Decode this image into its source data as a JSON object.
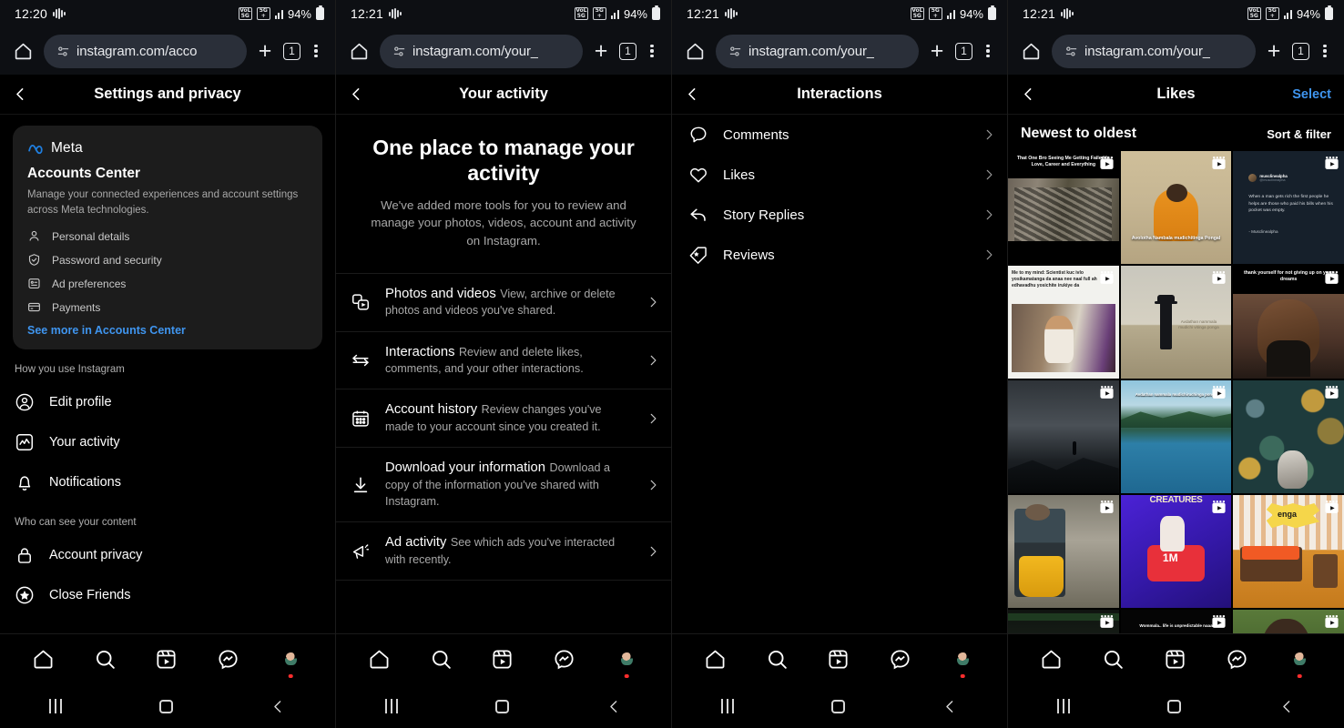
{
  "status": {
    "time_1": "12:20",
    "time_2": "12:21",
    "time_3": "12:21",
    "time_4": "12:21",
    "battery": "94%",
    "net_badge_1": "VoLTE 5G",
    "net_badge_2": "5G+",
    "icons": [
      "audio-wave-icon",
      "volte-icon",
      "fiveg-icon",
      "signal-bars-icon",
      "battery-icon"
    ]
  },
  "browser": {
    "url_1": "instagram.com/acco",
    "url_2": "instagram.com/your_",
    "url_3": "instagram.com/your_",
    "url_4": "instagram.com/your_",
    "tab_count": "1",
    "new_tab_label": "+",
    "icons": [
      "home-icon",
      "page-info-icon",
      "new-tab-icon",
      "tab-switcher-icon",
      "overflow-menu-icon"
    ]
  },
  "panel1": {
    "header": {
      "title": "Settings and privacy",
      "back": "back-icon"
    },
    "meta_card": {
      "brand": "Meta",
      "title": "Accounts Center",
      "description": "Manage your connected experiences and account settings across Meta technologies.",
      "items": [
        {
          "label": "Personal details",
          "icon": "person-icon"
        },
        {
          "label": "Password and security",
          "icon": "shield-check-icon"
        },
        {
          "label": "Ad preferences",
          "icon": "ad-preferences-icon"
        },
        {
          "label": "Payments",
          "icon": "credit-card-icon"
        }
      ],
      "link": "See more in Accounts Center",
      "link_color": "#3f95ef"
    },
    "sections": [
      {
        "label": "How you use Instagram",
        "items": [
          {
            "label": "Edit profile",
            "icon": "profile-circle-icon"
          },
          {
            "label": "Your activity",
            "icon": "activity-chart-icon"
          },
          {
            "label": "Notifications",
            "icon": "bell-icon"
          }
        ]
      },
      {
        "label": "Who can see your content",
        "items": [
          {
            "label": "Account privacy",
            "icon": "lock-icon"
          },
          {
            "label": "Close Friends",
            "icon": "star-circle-icon"
          }
        ]
      }
    ]
  },
  "panel2": {
    "header": {
      "title": "Your activity",
      "back": "back-icon"
    },
    "hero": {
      "title": "One place to manage your activity",
      "subtitle": "We've added more tools for you to review and manage your photos, videos, account and activity on Instagram."
    },
    "rows": [
      {
        "title": "Photos and videos",
        "subtitle": "View, archive or delete photos and videos you've shared.",
        "icon": "photos-videos-icon"
      },
      {
        "title": "Interactions",
        "subtitle": "Review and delete likes, comments, and your other interactions.",
        "icon": "interactions-arrows-icon"
      },
      {
        "title": "Account history",
        "subtitle": "Review changes you've made to your account since you created it.",
        "icon": "calendar-icon"
      },
      {
        "title": "Download your information",
        "subtitle": "Download a copy of the information you've shared with Instagram.",
        "icon": "download-icon"
      },
      {
        "title": "Ad activity",
        "subtitle": "See which ads you've interacted with recently.",
        "icon": "megaphone-icon"
      }
    ]
  },
  "panel3": {
    "header": {
      "title": "Interactions",
      "back": "back-icon"
    },
    "rows": [
      {
        "label": "Comments",
        "icon": "comment-bubble-icon"
      },
      {
        "label": "Likes",
        "icon": "heart-icon"
      },
      {
        "label": "Story Replies",
        "icon": "reply-arrow-icon"
      },
      {
        "label": "Reviews",
        "icon": "tag-star-icon"
      }
    ]
  },
  "panel4": {
    "header": {
      "title": "Likes",
      "back": "back-icon",
      "action": "Select",
      "action_color": "#3f95ef"
    },
    "sort": {
      "current": "Newest to oldest",
      "filter": "Sort & filter"
    },
    "grid": [
      {
        "id": "cell-1",
        "caption": "That One Bro Seeing Me Getting Failed In Love, Career and Everything",
        "caption_color": "#ffffff",
        "reel": true,
        "style": "aerial-ruins"
      },
      {
        "id": "cell-2",
        "caption": "Avolotha Nambala mudichitinga Pongal",
        "caption_color": "#ffffff",
        "reel": true,
        "style": "desert-man-orange"
      },
      {
        "id": "cell-3",
        "caption": "When a man gets rich the first people he helps are those who paid his bills when his pocket was empty.",
        "caption_color": "#d7dbe0",
        "reel": true,
        "style": "tweet-card",
        "handle": "musclinealpha",
        "handle_sub": "@musclinealpha",
        "signature": "- Musclinealpha"
      },
      {
        "id": "cell-4",
        "caption": "Me to my mind: Scientist kuc ivlo yosikamatanga da anaa nee naal full ah edhavadhu yosichite irukiye da",
        "caption_color": "#1c1c1c",
        "reel": true,
        "style": "meme-white-top"
      },
      {
        "id": "cell-5",
        "caption": "Avdathan nammala mudichi vitinga ponga",
        "caption_color": "#d8d2c4",
        "reel": true,
        "style": "field-hat-man"
      },
      {
        "id": "cell-6",
        "caption": "thank yourself for not giving up on your dreams",
        "caption_color": "#ffffff",
        "reel": true,
        "style": "portrait-man"
      },
      {
        "id": "cell-7",
        "caption": "",
        "caption_color": "#bdbdbd",
        "reel": true,
        "style": "cliff-silhouette"
      },
      {
        "id": "cell-8",
        "caption": "Avdathan nammala mudichiruchinga ponga",
        "caption_color": "#ffffff",
        "reel": true,
        "style": "lake-landscape"
      },
      {
        "id": "cell-9",
        "caption": "",
        "caption_color": "#ffffff",
        "reel": true,
        "style": "floral-wallpaper"
      },
      {
        "id": "cell-10",
        "caption": "",
        "caption_color": "#ffffff",
        "reel": true,
        "style": "boy-bucket"
      },
      {
        "id": "cell-11",
        "caption": "1M",
        "caption_color": "#ffffff",
        "reel": true,
        "style": "one-million-blue",
        "banner": "CREATURES"
      },
      {
        "id": "cell-12",
        "caption": "enga",
        "caption_color": "#1a1a1a",
        "reel": true,
        "style": "room-orange"
      },
      {
        "id": "cell-13",
        "caption": "",
        "caption_color": "#ffffff",
        "reel": true,
        "style": "dark-video"
      },
      {
        "id": "cell-14",
        "caption": "Wommala.. life is unpredictable naaa",
        "caption_color": "#ffffff",
        "reel": true,
        "style": "dark-caption"
      },
      {
        "id": "cell-15",
        "caption": "",
        "caption_color": "#ffffff",
        "reel": true,
        "style": "green-selfie"
      }
    ]
  },
  "tabbar": {
    "items": [
      {
        "name": "home",
        "icon": "home-icon"
      },
      {
        "name": "search",
        "icon": "search-icon"
      },
      {
        "name": "reels",
        "icon": "reels-icon"
      },
      {
        "name": "messages",
        "icon": "messenger-icon"
      },
      {
        "name": "profile",
        "icon": "avatar-icon"
      }
    ]
  },
  "androidnav": {
    "recents": "recents-icon",
    "home": "home-square-icon",
    "back": "back-chevron-icon"
  }
}
